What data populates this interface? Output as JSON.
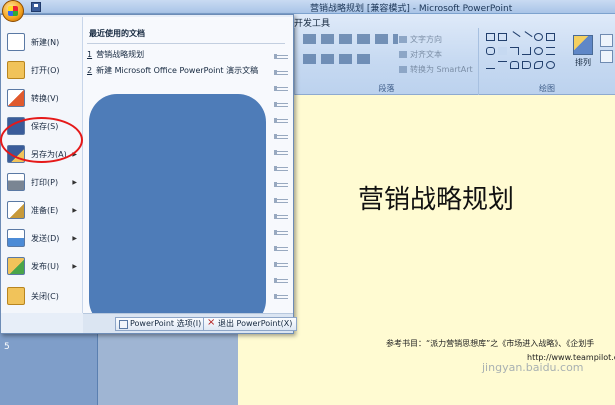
{
  "window": {
    "title": "营销战略规划 [兼容模式] - Microsoft PowerPoint"
  },
  "ribbon": {
    "visible_tab": "开发工具",
    "paragraph_group": {
      "label": "段落",
      "commands": [
        "文字方向",
        "对齐文本",
        "转换为 SmartArt"
      ]
    },
    "drawing_group": {
      "label": "绘图",
      "arrange_label": "排列"
    }
  },
  "office_menu": {
    "items": [
      {
        "label": "新建(N)",
        "icon": "new-document-icon",
        "has_submenu": false
      },
      {
        "label": "打开(O)",
        "icon": "open-folder-icon",
        "has_submenu": false
      },
      {
        "label": "转换(V)",
        "icon": "convert-icon",
        "has_submenu": false
      },
      {
        "label": "保存(S)",
        "icon": "save-disk-icon",
        "has_submenu": false
      },
      {
        "label": "另存为(A)",
        "icon": "save-as-icon",
        "has_submenu": true
      },
      {
        "label": "打印(P)",
        "icon": "printer-icon",
        "has_submenu": true
      },
      {
        "label": "准备(E)",
        "icon": "prepare-icon",
        "has_submenu": true
      },
      {
        "label": "发送(D)",
        "icon": "send-icon",
        "has_submenu": true
      },
      {
        "label": "发布(U)",
        "icon": "publish-icon",
        "has_submenu": true
      },
      {
        "label": "关闭(C)",
        "icon": "close-folder-icon",
        "has_submenu": false
      }
    ],
    "recent": {
      "header": "最近使用的文档",
      "files": [
        {
          "num": "1",
          "name": "营销战略规划"
        },
        {
          "num": "2",
          "name": "新建 Microsoft Office PowerPoint 演示文稿"
        }
      ]
    },
    "footer": {
      "options_label": "PowerPoint 选项(I)",
      "exit_label": "退出 PowerPoint(X)"
    }
  },
  "slide": {
    "title": "营销战略规划",
    "reference": "参考书目：“派力营销思想库”之《市场进入战略》、《企划手",
    "url": "http://www.teampilot.com"
  },
  "thumbnails": {
    "current_number": "5"
  },
  "watermark": "jingyan.baidu.com",
  "colors": {
    "highlight_circle": "#e51919",
    "redaction_blob": "#4e7cb8",
    "slide_background": "#fffbd2"
  }
}
